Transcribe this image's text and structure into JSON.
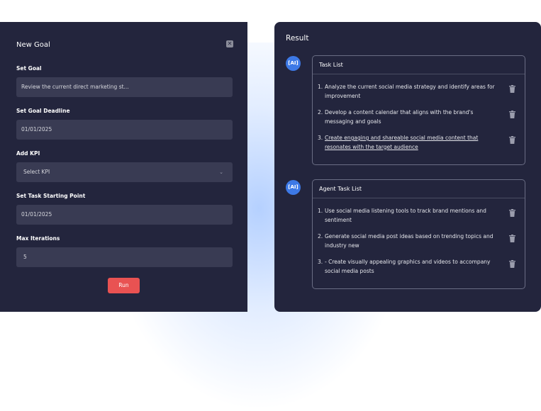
{
  "goal_form": {
    "title": "New Goal",
    "close_icon": "close-icon",
    "set_goal_label": "Set Goal",
    "set_goal_value": "Review the current direct marketing st...",
    "deadline_label": "Set Goal Deadline",
    "deadline_value": "01/01/2025",
    "kpi_label": "Add KPI",
    "kpi_placeholder": "Select KPI",
    "start_label": "Set Task Starting Point",
    "start_value": "01/01/2025",
    "iterations_label": "Max Iterations",
    "iterations_value": "5",
    "run_label": "Run"
  },
  "result": {
    "title": "Result",
    "sections": [
      {
        "badge": "[AI]",
        "heading": "Task List",
        "items": [
          {
            "num": "1.",
            "text": "Analyze the current social media strategy and identify areas for improvement"
          },
          {
            "num": "2.",
            "text": "Develop a content calendar that aligns with the brand's messaging and goals"
          },
          {
            "num": "3.",
            "text": "Create engaging and shareable social media content that resonates with the target audience"
          }
        ]
      },
      {
        "badge": "[AI]",
        "heading": "Agent Task List",
        "items": [
          {
            "num": "1.",
            "text": "Use social media listening tools to track brand mentions and sentiment"
          },
          {
            "num": "2.",
            "text": "Generate social media post ideas based on trending topics and industry new"
          },
          {
            "num": "3.",
            "text": "- Create visually appealing graphics and videos to accompany social media posts"
          }
        ]
      }
    ]
  },
  "colors": {
    "panel_bg": "#23253d",
    "input_bg": "#393b53",
    "run_button": "#e95252",
    "ai_badge": "#3d79e6"
  },
  "icons": {
    "delete": "trash-icon",
    "dropdown": "chevron-down-icon"
  }
}
